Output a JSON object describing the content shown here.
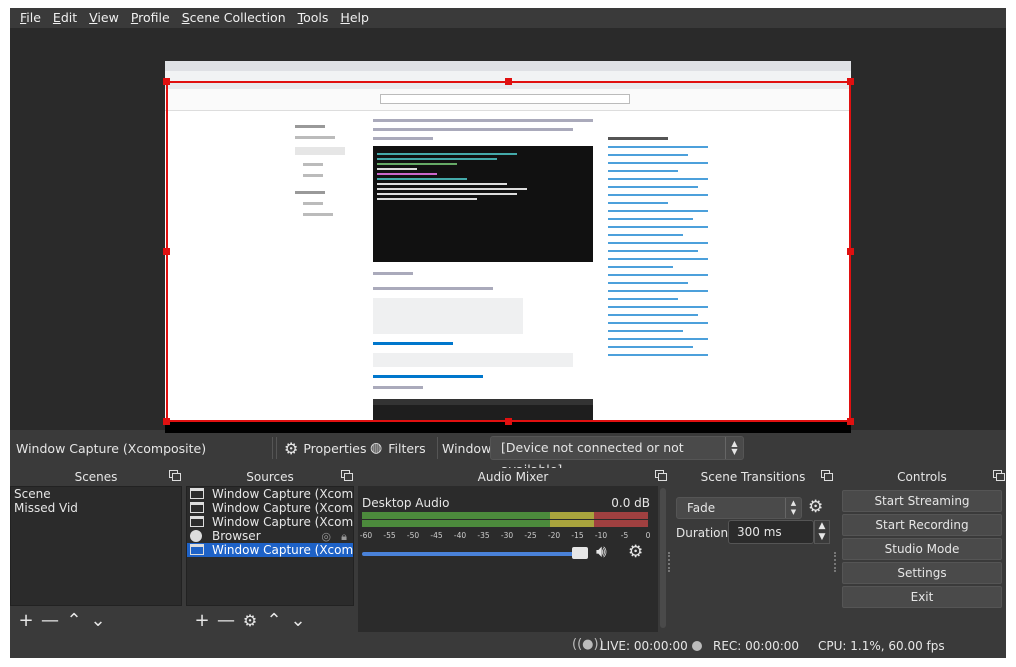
{
  "menu": [
    {
      "label": "File",
      "mnemonic": "F"
    },
    {
      "label": "Edit",
      "mnemonic": "E"
    },
    {
      "label": "View",
      "mnemonic": "V"
    },
    {
      "label": "Profile",
      "mnemonic": "P"
    },
    {
      "label": "Scene Collection",
      "mnemonic": "S"
    },
    {
      "label": "Tools",
      "mnemonic": "T"
    },
    {
      "label": "Help",
      "mnemonic": "H"
    }
  ],
  "props_bar": {
    "source_name": "Window Capture (Xcomposite)",
    "properties_label": "Properties",
    "filters_label": "Filters",
    "window_label": "Window",
    "window_value": "[Device not connected or not available]"
  },
  "scenes": {
    "title": "Scenes",
    "items": [
      "Scene",
      "Missed Vid"
    ]
  },
  "sources": {
    "title": "Sources",
    "items": [
      {
        "label": "Window Capture (Xcomposite)",
        "icon": "window-icon",
        "selected": false
      },
      {
        "label": "Window Capture (Xcomposite)",
        "icon": "window-icon",
        "selected": false
      },
      {
        "label": "Window Capture (Xcomposite)",
        "icon": "window-icon",
        "selected": false
      },
      {
        "label": "Browser",
        "icon": "globe-icon",
        "selected": false,
        "hidden": true,
        "locked": true
      },
      {
        "label": "Window Capture (Xcomposite)",
        "icon": "window-icon",
        "selected": true
      }
    ]
  },
  "mixer": {
    "title": "Audio Mixer",
    "channel": "Desktop Audio",
    "db": "0.0 dB",
    "ticks": [
      "-60",
      "-55",
      "-50",
      "-45",
      "-40",
      "-35",
      "-30",
      "-25",
      "-20",
      "-15",
      "-10",
      "-5",
      "0"
    ],
    "volume_fraction": 1.0
  },
  "transitions": {
    "title": "Scene Transitions",
    "selected": "Fade",
    "duration_label": "Duration",
    "duration_value": "300 ms"
  },
  "controls": {
    "title": "Controls",
    "buttons": [
      "Start Streaming",
      "Start Recording",
      "Studio Mode",
      "Settings",
      "Exit"
    ]
  },
  "status": {
    "live": "LIVE: 00:00:00",
    "rec": "REC: 00:00:00",
    "cpu": "CPU: 1.1%, 60.00 fps"
  },
  "colors": {
    "background": "#3a3a3a",
    "panel": "#2b2b2b",
    "selection": "#1e62c7",
    "transform_box": "#e01010"
  }
}
